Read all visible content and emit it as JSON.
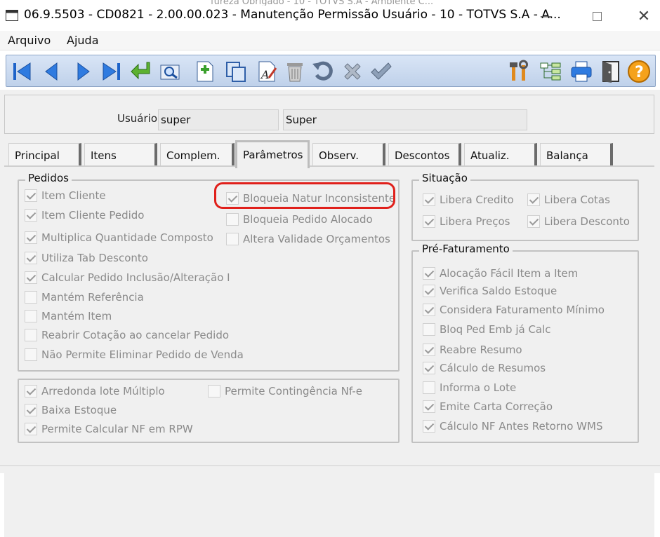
{
  "window": {
    "title": "06.9.5503 - CD0821 - 2.00.00.023 - Manutenção Permissão Usuário - 10 - TOTVS S.A - A...",
    "background_strip": "fureza Obrigado - 10 - TOTVS S.A - Ambiente C..."
  },
  "menu": {
    "arquivo": "Arquivo",
    "ajuda": "Ajuda"
  },
  "toolbar": {
    "icons": [
      "first-icon",
      "prev-icon",
      "next-icon",
      "last-icon",
      "goto-icon",
      "search-icon",
      "new-icon",
      "copy-icon",
      "edit-icon",
      "delete-icon",
      "undo-icon",
      "cancel-icon",
      "save-icon",
      "tools-icon",
      "tree-icon",
      "print-icon",
      "exit-icon",
      "help-icon"
    ]
  },
  "user": {
    "label": "Usuário:",
    "code": "super",
    "name": "Super"
  },
  "tabs": [
    "Principal",
    "Itens",
    "Complem.",
    "Parâmetros",
    "Observ.",
    "Descontos",
    "Atualiz.",
    "Balança"
  ],
  "active_tab": "Parâmetros",
  "pedidos": {
    "legend": "Pedidos",
    "left": [
      {
        "label": "Item Cliente",
        "checked": true
      },
      {
        "label": "Item Cliente Pedido",
        "checked": true
      },
      {
        "label": "Multiplica Quantidade Composto",
        "checked": true
      },
      {
        "label": "Utiliza Tab Desconto",
        "checked": true
      },
      {
        "label": "Calcular Pedido Inclusão/Alteração I",
        "checked": true
      },
      {
        "label": "Mantém Referência",
        "checked": false
      },
      {
        "label": "Mantém Item",
        "checked": false
      },
      {
        "label": "Reabrir Cotação ao cancelar Pedido",
        "checked": false
      },
      {
        "label": "Não Permite Eliminar Pedido de Venda",
        "checked": false
      }
    ],
    "right": [
      {
        "label": "Bloqueia Natur Inconsistente",
        "checked": true
      },
      {
        "label": "Bloqueia Pedido Alocado",
        "checked": false
      },
      {
        "label": "Altera Validade Orçamentos",
        "checked": false
      }
    ]
  },
  "lower": [
    {
      "label": "Arredonda lote Múltiplo",
      "checked": true
    },
    {
      "label": "Baixa Estoque",
      "checked": true
    },
    {
      "label": "Permite Calcular NF em RPW",
      "checked": true
    },
    {
      "label": "Permite Contingência Nf-e",
      "checked": false
    }
  ],
  "situacao": {
    "legend": "Situação",
    "items": [
      {
        "label": "Libera Credito",
        "checked": true
      },
      {
        "label": "Libera Cotas",
        "checked": true
      },
      {
        "label": "Libera Preços",
        "checked": true
      },
      {
        "label": "Libera Desconto",
        "checked": true
      }
    ]
  },
  "prefat": {
    "legend": "Pré-Faturamento",
    "items": [
      {
        "label": "Alocação Fácil Item a Item",
        "checked": true
      },
      {
        "label": "Verifica Saldo Estoque",
        "checked": true
      },
      {
        "label": "Considera Faturamento Mínimo",
        "checked": true
      },
      {
        "label": "Bloq Ped Emb já Calc",
        "checked": false
      },
      {
        "label": "Reabre Resumo",
        "checked": true
      },
      {
        "label": "Cálculo de Resumos",
        "checked": true
      },
      {
        "label": "Informa o Lote",
        "checked": false
      },
      {
        "label": "Emite Carta Correção",
        "checked": true
      },
      {
        "label": "Cálculo NF Antes Retorno WMS",
        "checked": true
      }
    ]
  }
}
